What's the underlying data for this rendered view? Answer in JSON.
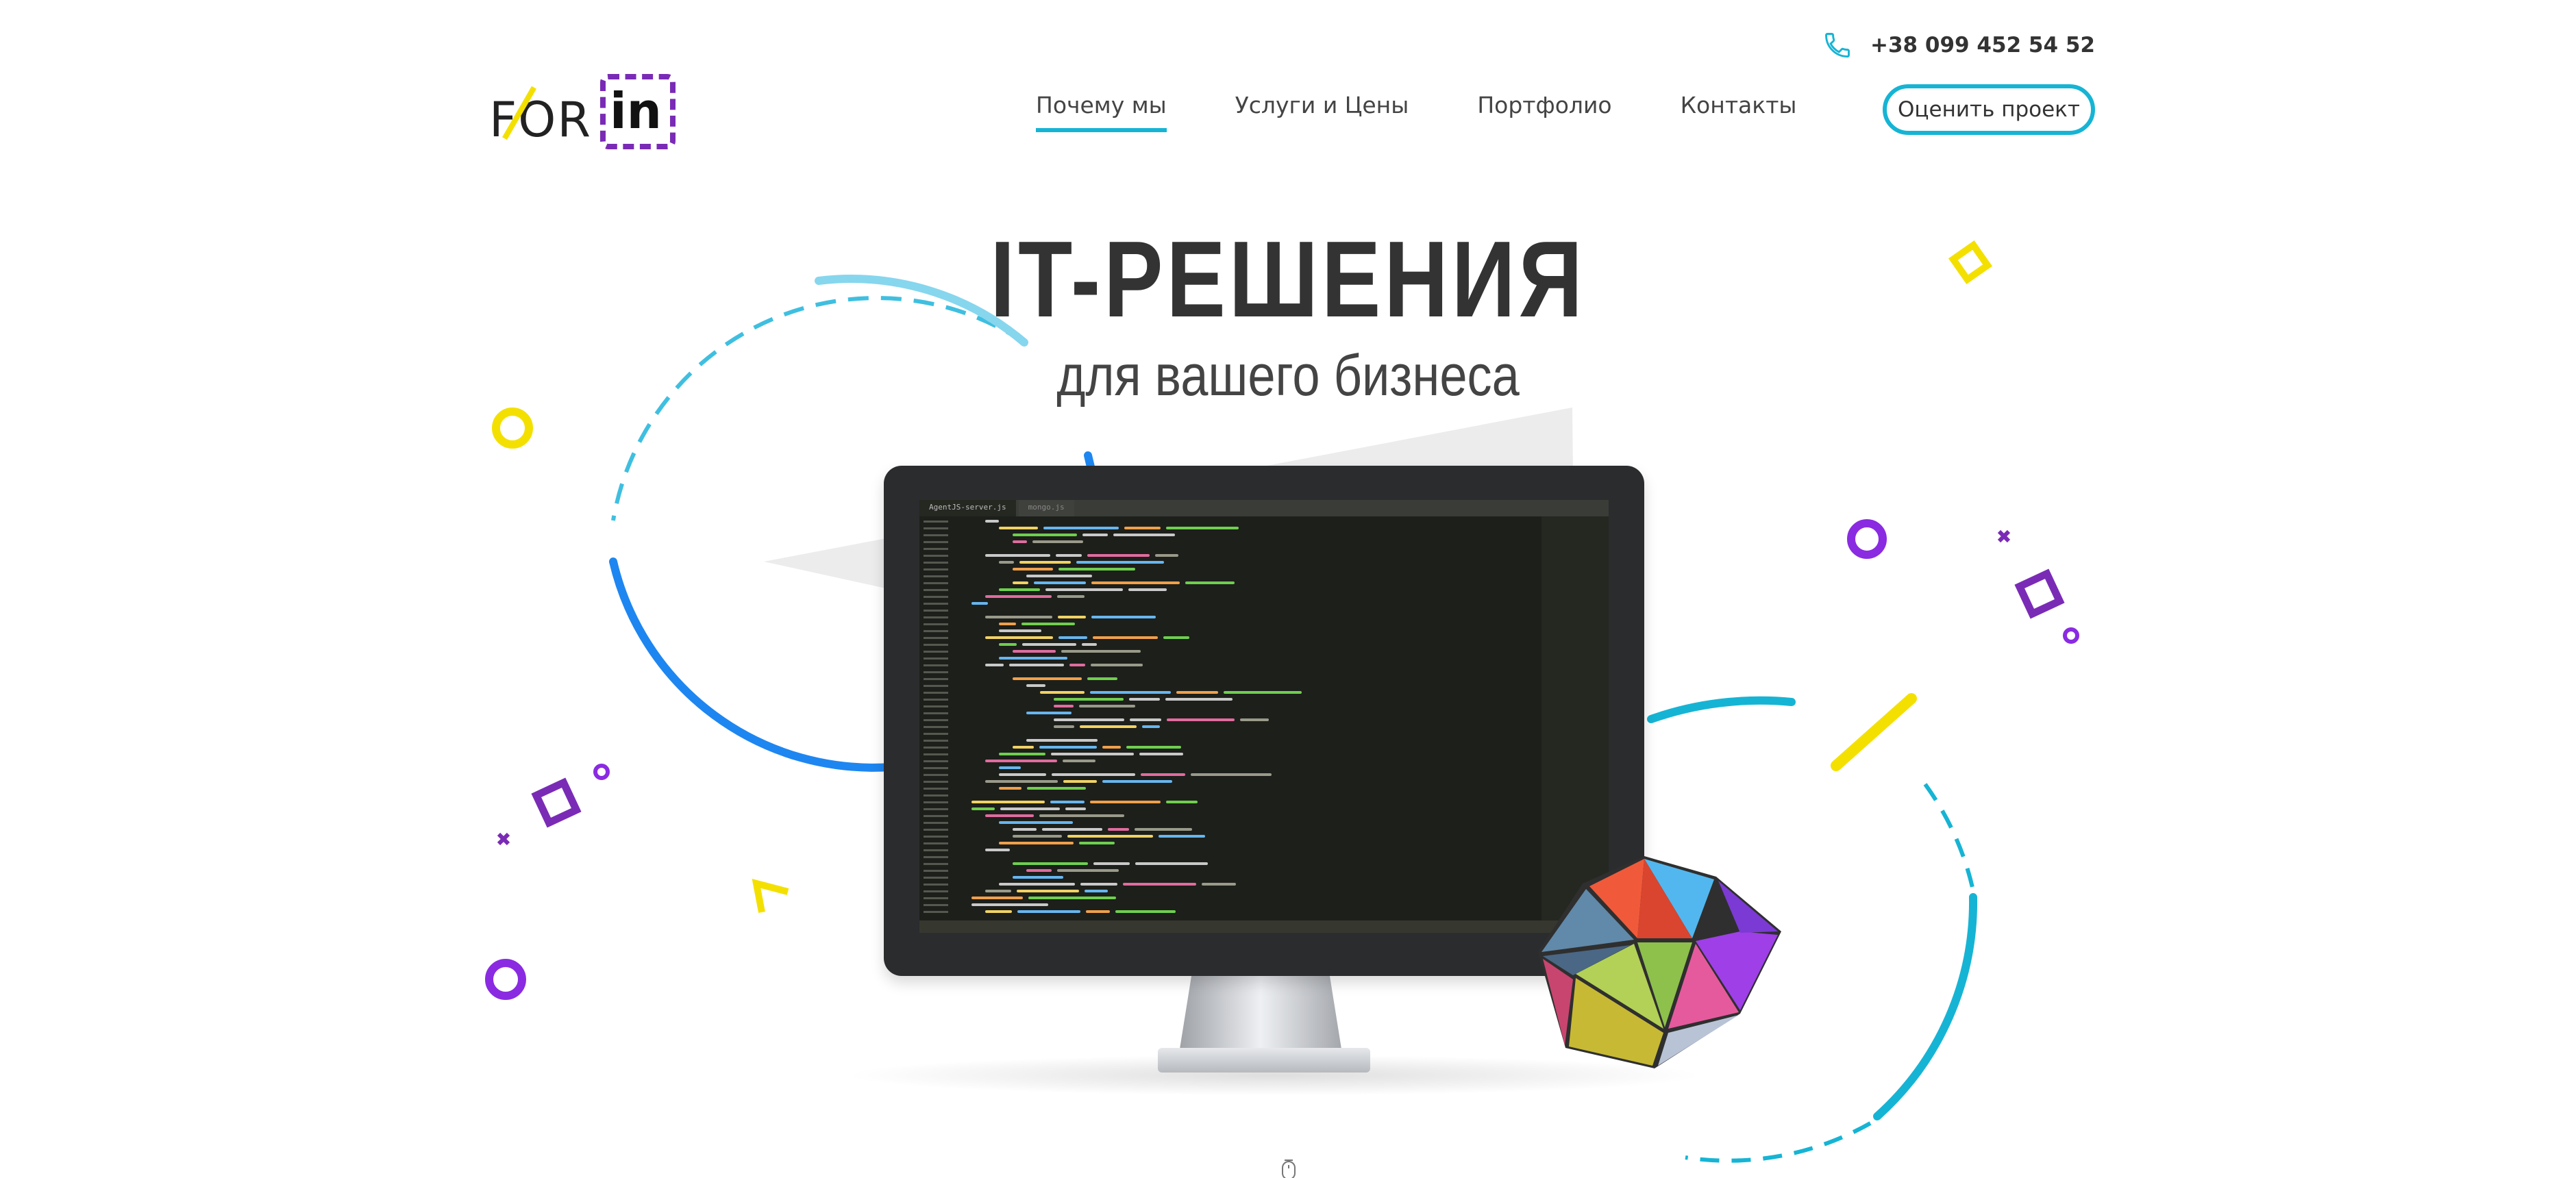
{
  "logo": {
    "part1": "FOR",
    "part2": "in"
  },
  "header": {
    "phone": "+38 099 452 54 52",
    "cta_label": "Оценить проект"
  },
  "nav": {
    "items": [
      {
        "label": "Почему мы",
        "active": true
      },
      {
        "label": "Услуги и Цены",
        "active": false
      },
      {
        "label": "Портфолио",
        "active": false
      },
      {
        "label": "Контакты",
        "active": false
      }
    ]
  },
  "hero": {
    "title": "IT-РЕШЕНИЯ",
    "subtitle": "для вашего бизнеса"
  },
  "editor": {
    "tabs": [
      "AgentJS-server.js",
      "mongo.js"
    ]
  },
  "colors": {
    "accent": "#16b4d4",
    "purple": "#7a2bb6",
    "yellow": "#f3e000",
    "blue": "#1e86f0"
  },
  "icons": {
    "phone": "phone-icon",
    "scroll": "mouse-scroll-icon"
  }
}
